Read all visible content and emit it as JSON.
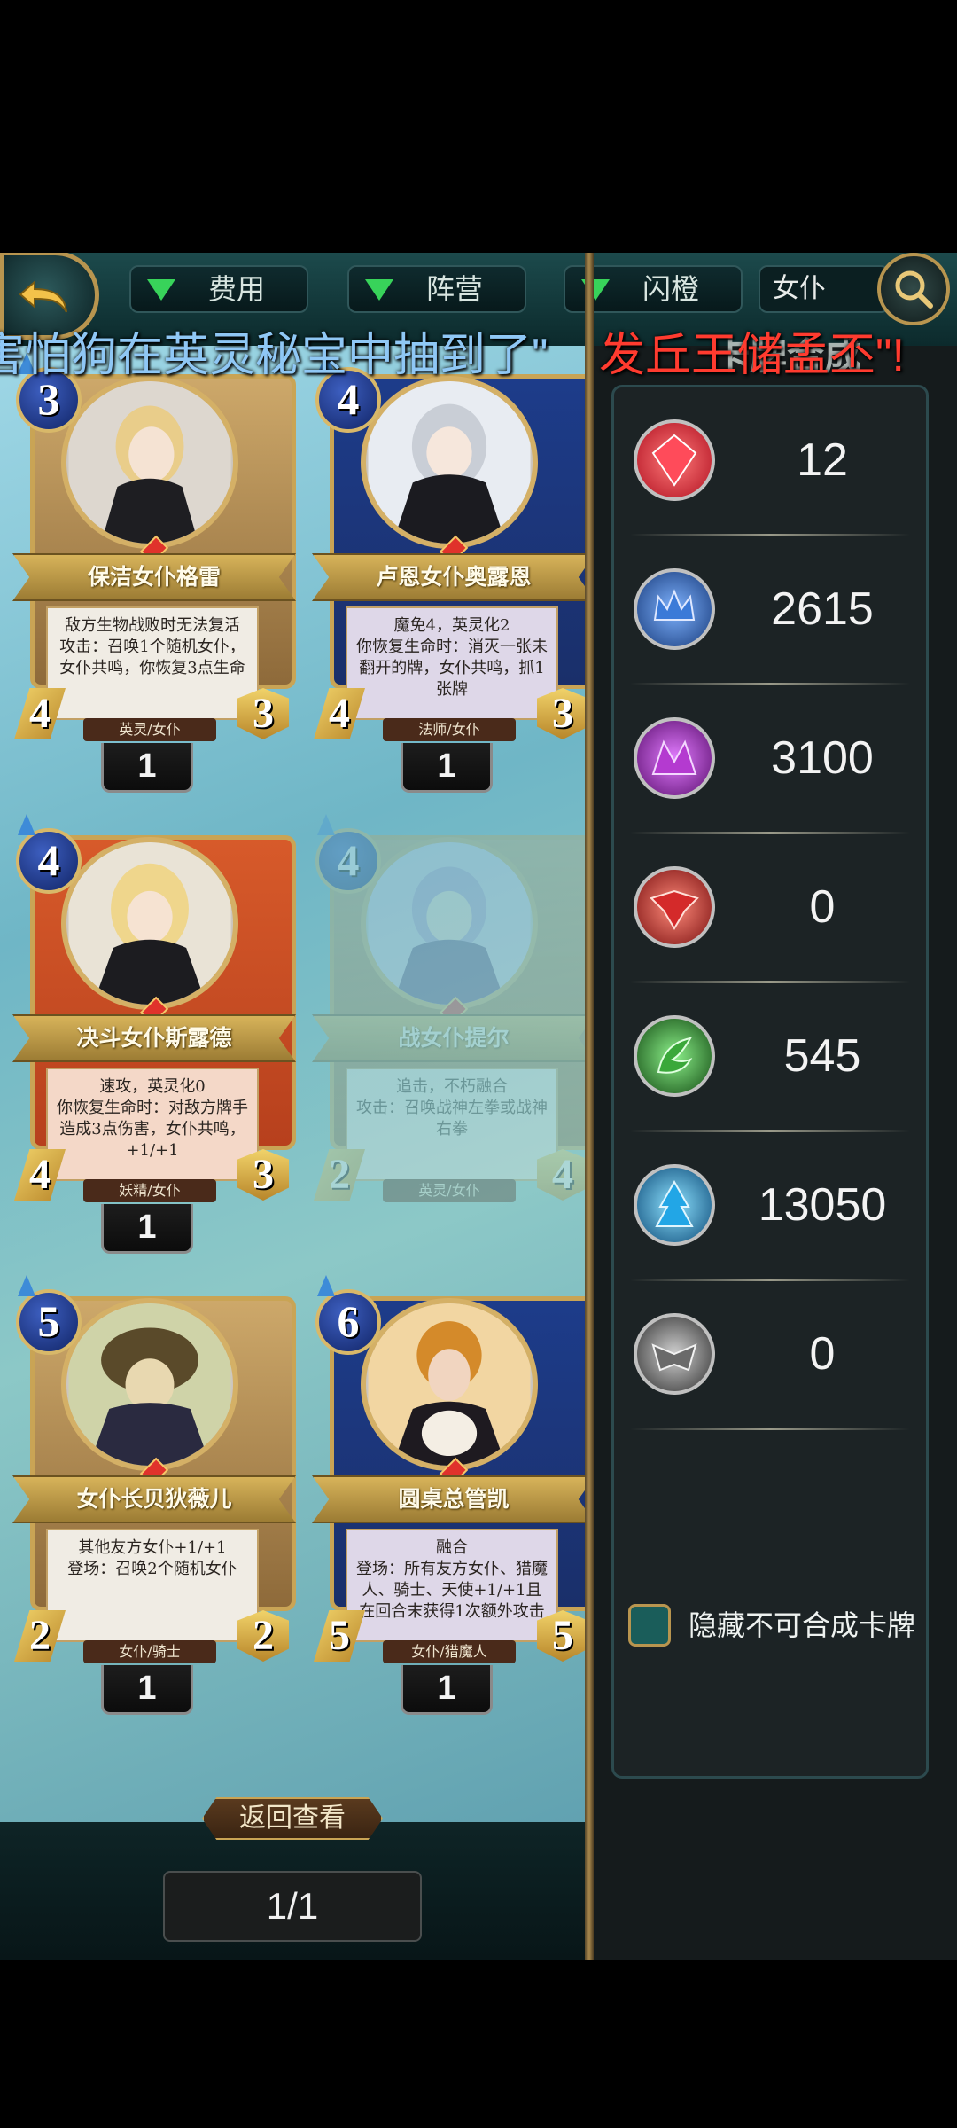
{
  "topbar": {
    "filters": [
      {
        "label": "费用"
      },
      {
        "label": "阵营"
      },
      {
        "label": "闪橙"
      }
    ],
    "search_value": "女仆"
  },
  "marquee": {
    "part1": "害怕狗在英灵秘宝中抽到了\"",
    "part2": "发丘王储孟丕\"!"
  },
  "cards": [
    {
      "name": "保洁女仆格雷",
      "cost": "3",
      "attack": "4",
      "health": "3",
      "tribe": "英灵/女仆",
      "count": "1",
      "desc": "敌方生物战败时无法复活\n攻击：召唤1个随机女仆，女仆共鸣，你恢复3点生命"
    },
    {
      "name": "卢恩女仆奥露恩",
      "cost": "4",
      "attack": "4",
      "health": "3",
      "tribe": "法师/女仆",
      "count": "1",
      "desc": "魔免4，英灵化2\n你恢复生命时：消灭一张未翻开的牌，女仆共鸣，抓1张牌"
    },
    {
      "name": "决斗女仆斯露德",
      "cost": "4",
      "attack": "4",
      "health": "3",
      "tribe": "妖精/女仆",
      "count": "1",
      "desc": "速攻，英灵化0\n你恢复生命时：对敌方牌手造成3点伤害，女仆共鸣，+1/+1"
    },
    {
      "name": "战女仆提尔",
      "cost": "4",
      "attack": "2",
      "health": "4",
      "tribe": "英灵/女仆",
      "count": "",
      "desc": "追击，不朽融合\n攻击：召唤战神左拳或战神右拳"
    },
    {
      "name": "女仆长贝狄薇儿",
      "cost": "5",
      "attack": "2",
      "health": "2",
      "tribe": "女仆/骑士",
      "count": "1",
      "desc": "其他友方女仆+1/+1\n登场：召唤2个随机女仆"
    },
    {
      "name": "圆桌总管凯",
      "cost": "6",
      "attack": "5",
      "health": "5",
      "tribe": "女仆/猎魔人",
      "count": "1",
      "desc": "融合\n登场：所有友方女仆、猎魔人、骑士、天使+1/+1且在回合末获得1次额外攻击"
    }
  ],
  "bottom": {
    "view_back_label": "返回查看",
    "page_indicator": "1/1"
  },
  "right_panel": {
    "title": "卡牌合成",
    "resources": [
      {
        "icon": "red-gem-icon",
        "value": "12",
        "color": "#e0303a"
      },
      {
        "icon": "blue-crown-icon",
        "value": "2615",
        "color": "#2e66b8"
      },
      {
        "icon": "purple-emblem-icon",
        "value": "3100",
        "color": "#a02ab8"
      },
      {
        "icon": "red-emblem-icon",
        "value": "0",
        "color": "#c42626"
      },
      {
        "icon": "green-emblem-icon",
        "value": "545",
        "color": "#2f8a2f"
      },
      {
        "icon": "cyan-emblem-icon",
        "value": "13050",
        "color": "#1f9fd6"
      },
      {
        "icon": "gray-emblem-icon",
        "value": "0",
        "color": "#6a6a6a"
      }
    ],
    "hide_label": "隐藏不可合成卡牌"
  }
}
